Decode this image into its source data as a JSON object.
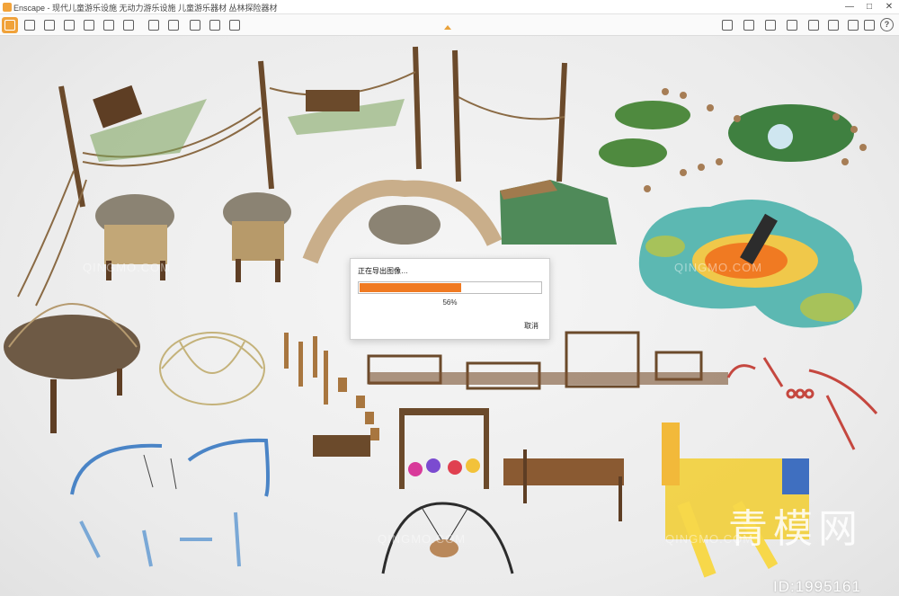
{
  "window": {
    "title": "Enscape - 现代儿童游乐设施 无动力游乐设施 儿童游乐器材 丛林探险器材",
    "controls": [
      "—",
      "□",
      "✕"
    ]
  },
  "toolbar": {
    "left_icons": [
      "home-icon",
      "connect-icon",
      "view-icon",
      "walk-icon",
      "settings-icon",
      "assets-icon",
      "render-icon",
      "export-icon",
      "batch-icon",
      "video-icon",
      "panorama-icon",
      "vr-icon"
    ],
    "right_icons": [
      "collab-icon",
      "monitor-icon",
      "web-icon",
      "image-icon",
      "atmosphere-icon",
      "capture-icon",
      "feedback-icon",
      "gear-icon"
    ],
    "help_label": "?"
  },
  "dialog": {
    "title": "正在导出图像…",
    "progress": 0.56,
    "progress_text": "56%",
    "cancel_label": "取消",
    "fill_color": "#f07a22"
  },
  "watermark": {
    "brand": "青模网",
    "id": "ID:1995161",
    "tile_text": "QINGMO.COM"
  }
}
